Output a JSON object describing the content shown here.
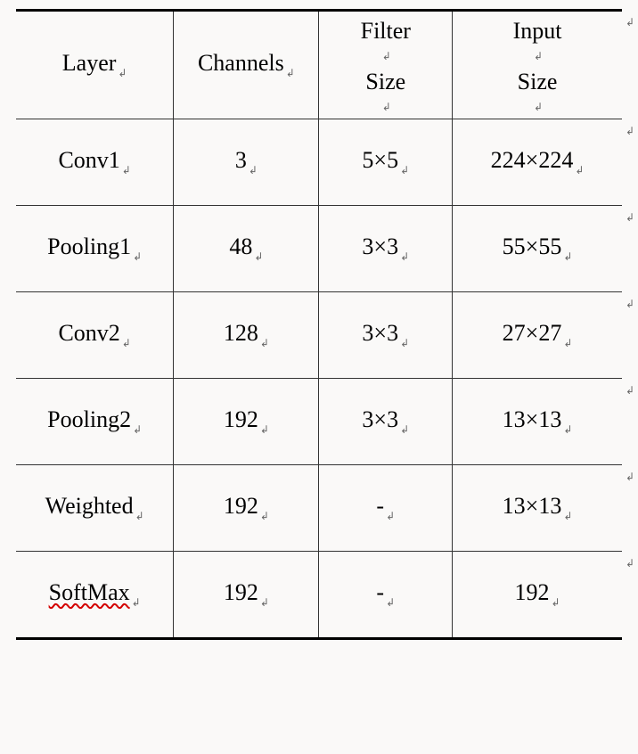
{
  "chart_data": {
    "type": "table",
    "headers": [
      "Layer",
      "Channels",
      "Filter Size",
      "Input Size"
    ],
    "rows": [
      [
        "Conv1",
        "3",
        "5×5",
        "224×224"
      ],
      [
        "Pooling1",
        "48",
        "3×3",
        "55×55"
      ],
      [
        "Conv2",
        "128",
        "3×3",
        "27×27"
      ],
      [
        "Pooling2",
        "192",
        "3×3",
        "13×13"
      ],
      [
        "Weighted",
        "192",
        "-",
        "13×13"
      ],
      [
        "SoftMax",
        "192",
        "-",
        "192"
      ]
    ]
  },
  "headers": {
    "layer": "Layer",
    "channels": "Channels",
    "filter_l1": "Filter",
    "filter_l2": "Size",
    "input_l1": "Input",
    "input_l2": "Size"
  },
  "rows": [
    {
      "layer": "Conv1",
      "channels": "3",
      "filter": "5×5",
      "input": "224×224",
      "squiggle": false
    },
    {
      "layer": "Pooling1",
      "channels": "48",
      "filter": "3×3",
      "input": "55×55",
      "squiggle": false
    },
    {
      "layer": "Conv2",
      "channels": "128",
      "filter": "3×3",
      "input": "27×27",
      "squiggle": false
    },
    {
      "layer": "Pooling2",
      "channels": "192",
      "filter": "3×3",
      "input": "13×13",
      "squiggle": false
    },
    {
      "layer": "Weighted",
      "channels": "192",
      "filter": "-",
      "input": "13×13",
      "squiggle": false
    },
    {
      "layer": "SoftMax",
      "channels": "192",
      "filter": "-",
      "input": "192",
      "squiggle": true
    }
  ],
  "mark": "↲"
}
